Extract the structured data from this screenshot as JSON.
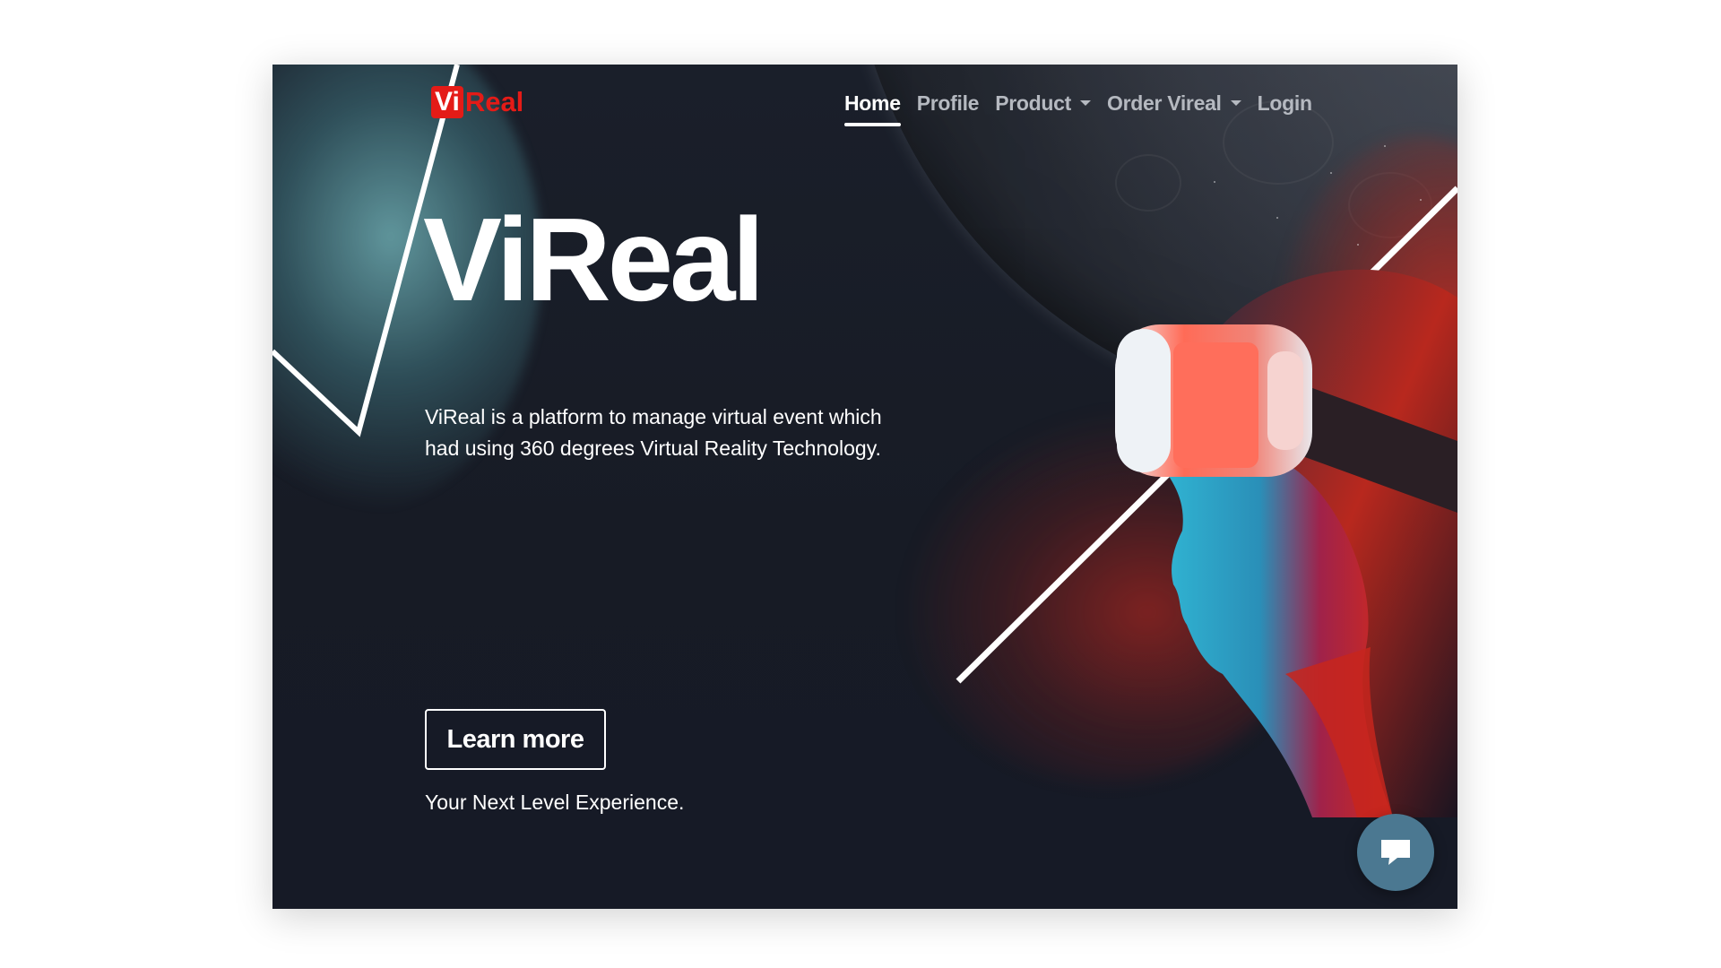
{
  "brand": {
    "logo_vi": "Vi",
    "logo_real": "Real"
  },
  "nav": {
    "items": [
      {
        "label": "Home",
        "active": true,
        "dropdown": false
      },
      {
        "label": "Profile",
        "active": false,
        "dropdown": false
      },
      {
        "label": "Product",
        "active": false,
        "dropdown": true
      },
      {
        "label": "Order Vireal",
        "active": false,
        "dropdown": true
      },
      {
        "label": "Login",
        "active": false,
        "dropdown": false
      }
    ]
  },
  "hero": {
    "title": "ViReal",
    "description": "ViReal is a platform to manage virtual event which had using 360 degrees Virtual Reality Technology.",
    "cta_label": "Learn more",
    "tagline": "Your Next Level Experience."
  },
  "colors": {
    "brand_red": "#e41b17",
    "background": "#171b25",
    "chat_button": "#4b7891",
    "nav_inactive": "#b5b9c0"
  },
  "icons": {
    "chat": "chat-bubble-icon",
    "dropdown": "caret-down-icon"
  }
}
